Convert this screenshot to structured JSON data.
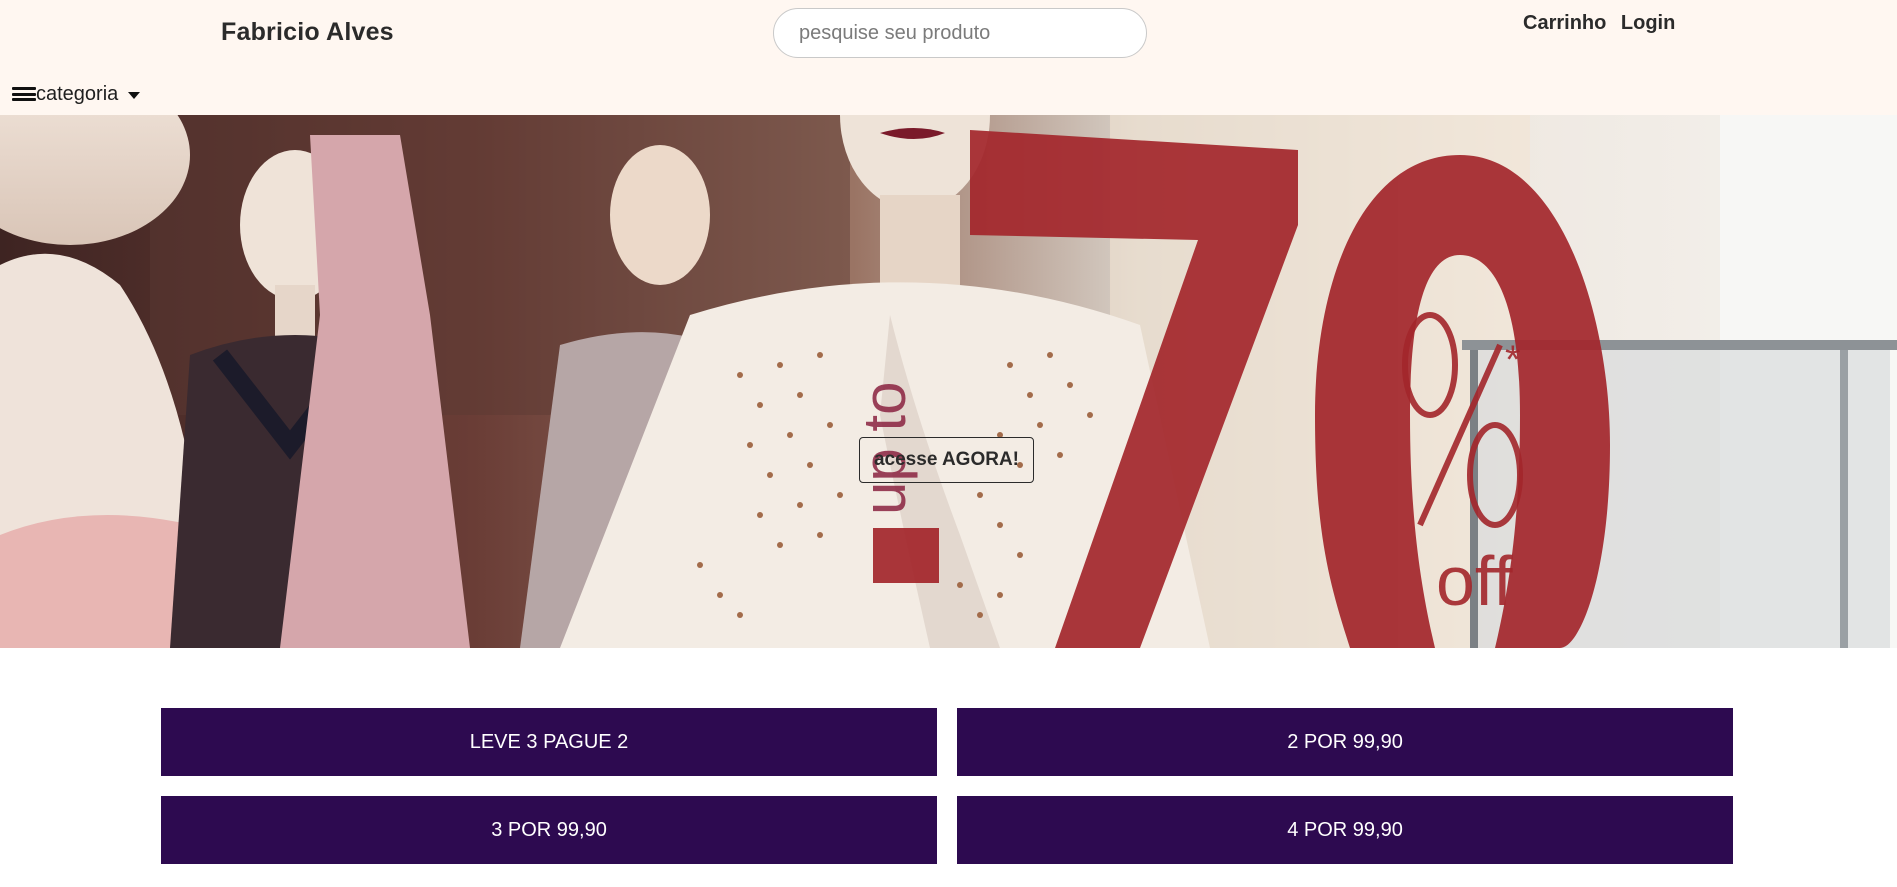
{
  "header": {
    "brand": "Fabricio Alves",
    "search_placeholder": "pesquise seu produto",
    "cart_label": "Carrinho",
    "login_label": "Login"
  },
  "category_menu": {
    "label": "categoria"
  },
  "hero": {
    "cta_label": "acesse AGORA!",
    "sale_text": "up to 70% off*"
  },
  "promos": [
    {
      "label": "LEVE 3 PAGUE 2"
    },
    {
      "label": "2 POR 99,90"
    },
    {
      "label": "3 POR 99,90"
    },
    {
      "label": "4 POR 99,90"
    }
  ],
  "colors": {
    "header_bg": "#fff7f1",
    "promo_bg": "#2d0a50",
    "promo_text": "#ffffff",
    "sale_red": "#a3262b"
  }
}
